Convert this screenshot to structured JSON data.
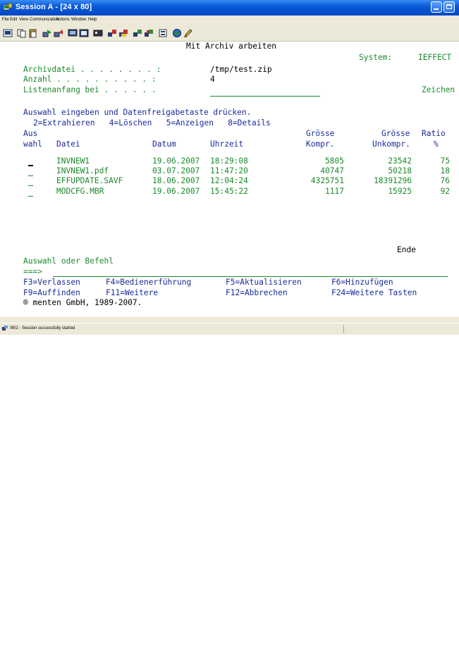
{
  "window": {
    "title": "Session A - [24 x 80]"
  },
  "menu": [
    "File",
    "Edit",
    "View",
    "Communication",
    "Actions",
    "Window",
    "Help"
  ],
  "toolbar_icons": [
    "print-icon",
    "copy-icon",
    "paste-icon",
    "send-icon",
    "receive-icon",
    "display-icon",
    "keyboard-icon",
    "macro-icon",
    "record-icon",
    "play-icon",
    "start-icon",
    "stop-icon",
    "list-icon",
    "globe-icon",
    "edit-icon"
  ],
  "screen": {
    "title": "Mit Archiv arbeiten",
    "system_label": "System:",
    "system_value": "IEFFECT",
    "archivdatei_label": "Archivdatei . . . . . . . . :",
    "archivdatei_value": "/tmp/test.zip",
    "anzahl_label": "Anzahl . . . . . . . . . . :",
    "anzahl_value": "4",
    "listenanfang_label": "Listenanfang bei . . . . . .",
    "zeichen_label": "Zeichen",
    "instruction": "Auswahl eingeben und Datenfreigabetaste drücken.",
    "options": "2=Extrahieren   4=Löschen   5=Anzeigen   8=Details",
    "headers": {
      "row1": {
        "aus": "Aus",
        "groesse1": "Grösse",
        "groesse2": "Grösse",
        "ratio": "Ratio"
      },
      "row2": {
        "wahl": "wahl",
        "datei": "Datei",
        "datum": "Datum",
        "uhrzeit": "Uhrzeit",
        "kompr": "Kompr.",
        "unkompr": "Unkompr.",
        "pct": "%"
      }
    },
    "rows": [
      {
        "datei": "INVNEW1",
        "datum": "19.06.2007",
        "uhrzeit": "18:29:08",
        "kompr": "5805",
        "unkompr": "23542",
        "ratio": "75"
      },
      {
        "datei": "INVNEW1.pdf",
        "datum": "03.07.2007",
        "uhrzeit": "11:47:20",
        "kompr": "40747",
        "unkompr": "50218",
        "ratio": "18"
      },
      {
        "datei": "EFFUPDATE.SAVF",
        "datum": "18.06.2007",
        "uhrzeit": "12:04:24",
        "kompr": "4325751",
        "unkompr": "18391296",
        "ratio": "76"
      },
      {
        "datei": "MODCFG.MBR",
        "datum": "19.06.2007",
        "uhrzeit": "15:45:22",
        "kompr": "1117",
        "unkompr": "15925",
        "ratio": "92"
      }
    ],
    "ende": "Ende",
    "auswahl_label": "Auswahl oder Befehl",
    "prompt": "===>",
    "fkeys": {
      "f3": "F3=Verlassen",
      "f4": "F4=Bedienerführung",
      "f5": "F5=Aktualisieren",
      "f6": "F6=Hinzufügen",
      "f9": "F9=Auffinden",
      "f11": "F11=Weitere",
      "f12": "F12=Abbrechen",
      "f24": "F24=Weitere Tasten"
    },
    "copyright": "® menten GmbH, 1989-2007."
  },
  "status": {
    "text": "I902 - Session successfully started"
  },
  "colors": {
    "green": "#1c8a2c",
    "blue": "#1a2b9a",
    "titlebar": "#0a5ad8"
  }
}
